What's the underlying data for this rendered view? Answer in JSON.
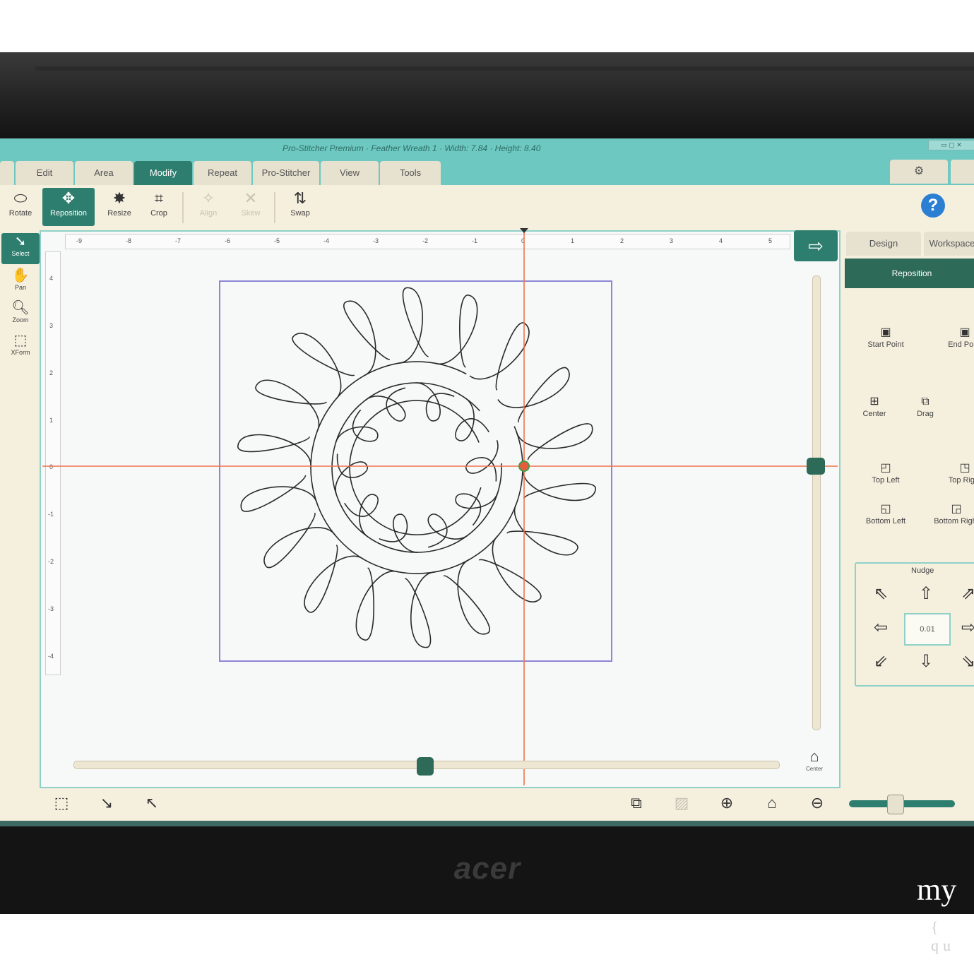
{
  "window": {
    "title": "Pro-Stitcher Premium  ·  Feather Wreath 1  ·  Width: 7.84  ·  Height: 8.40",
    "controls": "▭ ▢ ✕"
  },
  "tabs": [
    {
      "label": "Edit"
    },
    {
      "label": "Area"
    },
    {
      "label": "Modify"
    },
    {
      "label": "Repeat"
    },
    {
      "label": "Pro-Stitcher"
    },
    {
      "label": "View"
    },
    {
      "label": "Tools"
    }
  ],
  "settings_tab_icon": "gear-icon",
  "toolbar": {
    "rotate": "Rotate",
    "reposition": "Reposition",
    "resize": "Resize",
    "crop": "Crop",
    "align": "Align",
    "skew": "Skew",
    "swap": "Swap"
  },
  "help_label": "?",
  "left_tools": {
    "select": "Select",
    "pan": "Pan",
    "zoom": "Zoom",
    "xform": "XForm"
  },
  "ruler": {
    "top": [
      "-9",
      "-8",
      "-7",
      "-6",
      "-5",
      "-4",
      "-3",
      "-2",
      "-1",
      "0",
      "1",
      "2",
      "3",
      "4",
      "5"
    ],
    "left": [
      "4",
      "3",
      "2",
      "1",
      "0",
      "-1",
      "-2",
      "-3",
      "-4"
    ]
  },
  "right_panel": {
    "tab_design": "Design",
    "tab_workspace": "Workspace",
    "header": "Reposition",
    "start_point": "Start Point",
    "end_point": "End Point",
    "center": "Center",
    "drag": "Drag",
    "top_left": "Top Left",
    "top_right": "Top Right",
    "bottom_left": "Bottom Left",
    "bottom_right": "Bottom Right",
    "nudge_title": "Nudge",
    "nudge_value": "0.01"
  },
  "fit_label": "Center",
  "brand": "acer",
  "watermark": {
    "main": "my",
    "sub": "{ qu"
  },
  "colors": {
    "accent": "#2d7e6e",
    "title_bar": "#6cc8c0",
    "crosshair": "#f0734a",
    "design_box": "#8c86d6"
  }
}
